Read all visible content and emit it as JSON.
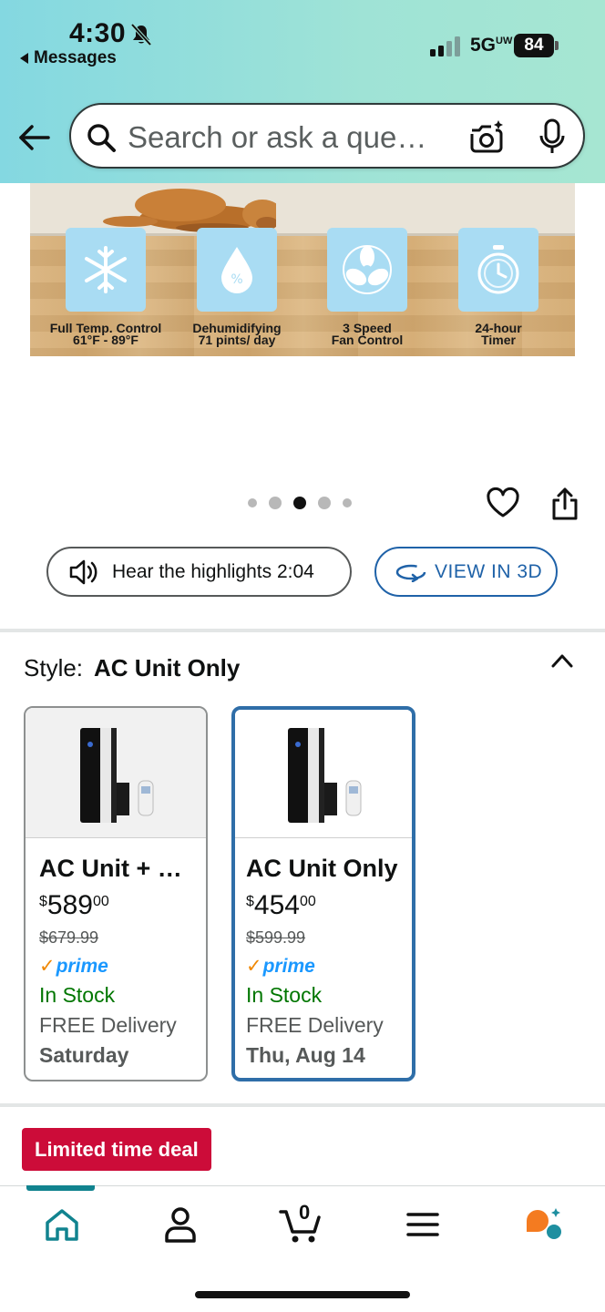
{
  "status_bar": {
    "time": "4:30",
    "back_app": "Messages",
    "network": "5G",
    "network_sup": "UW",
    "battery": "84"
  },
  "search": {
    "placeholder": "Search or ask a que…"
  },
  "product_image": {
    "features": [
      {
        "icon": "snowflake-icon",
        "line1": "Full Temp. Control",
        "line2": "61°F - 89°F"
      },
      {
        "icon": "droplet-icon",
        "line1": "Dehumidifying",
        "line2": "71 pints/ day"
      },
      {
        "icon": "fan-icon",
        "line1": "3 Speed",
        "line2": "Fan Control"
      },
      {
        "icon": "timer-icon",
        "line1": "24-hour",
        "line2": "Timer"
      }
    ]
  },
  "carousel": {
    "dot_count": 5,
    "active_index": 2
  },
  "actions": {
    "hear_label": "Hear the highlights 2:04",
    "view3d_label": "VIEW IN 3D"
  },
  "style_selector": {
    "prefix": "Style:",
    "value": "AC Unit Only",
    "options": [
      {
        "title": "AC Unit + …",
        "price_currency": "$",
        "price_whole": "589",
        "price_cents": "00",
        "list_price": "$679.99",
        "prime": "prime",
        "stock": "In Stock",
        "delivery": "FREE Delivery",
        "delivery_date": "Saturday",
        "selected": false
      },
      {
        "title": "AC Unit Only",
        "price_currency": "$",
        "price_whole": "454",
        "price_cents": "00",
        "list_price": "$599.99",
        "prime": "prime",
        "stock": "In Stock",
        "delivery": "FREE Delivery",
        "delivery_date": "Thu, Aug 14",
        "selected": true
      }
    ]
  },
  "deal_badge": "Limited time deal",
  "bottom_nav": {
    "cart_count": "0",
    "items": [
      "home-icon",
      "account-icon",
      "cart-icon",
      "menu-icon",
      "rufus-icon"
    ],
    "active": "home-icon"
  },
  "colors": {
    "header_gradient_start": "#84d8e1",
    "header_gradient_end": "#a6e6d2",
    "link_blue": "#1f62a8",
    "prime_blue": "#1a98ff",
    "in_stock_green": "#007600",
    "deal_red": "#cc0c39",
    "nav_teal": "#11838f",
    "rufus_orange": "#f47b20"
  }
}
